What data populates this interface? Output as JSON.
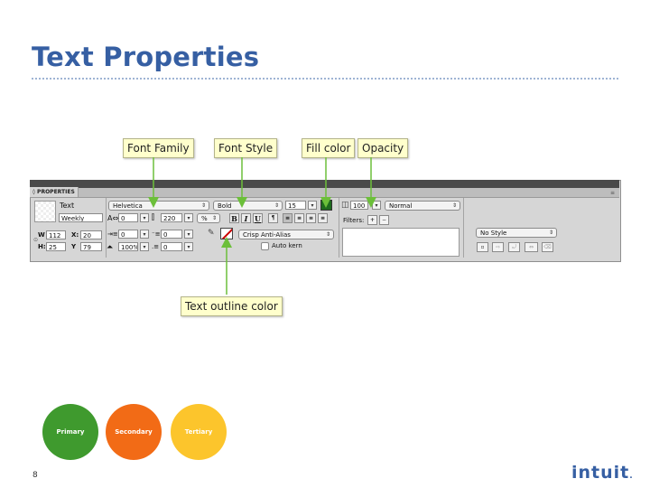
{
  "slide": {
    "title": "Text Properties",
    "page_number": "8",
    "logo_text": "intuit",
    "logo_mark": "."
  },
  "callouts": {
    "font_family": "Font Family",
    "font_style": "Font Style",
    "fill_color": "Fill color",
    "opacity": "Opacity",
    "text_outline_color": "Text outline color"
  },
  "panel": {
    "tab_label": "◊ PROPERTIES",
    "object_type": "Text",
    "object_name": "Weekly",
    "w_label": "W",
    "w_value": "112",
    "h_label": "H:",
    "h_value": "25",
    "x_label": "X:",
    "x_value": "20",
    "y_label": "Y",
    "y_value": "79",
    "font_family": "Helvetica",
    "font_style": "Bold",
    "font_size": "15",
    "kerning": "0",
    "leading": "220",
    "leading_unit": "%",
    "indent": "0",
    "space_before": "0",
    "space_after": "0",
    "horizontal_scale": "100%",
    "baseline_shift": "0",
    "bold_label": "B",
    "italic_label": "I",
    "underline_label": "U",
    "anti_alias": "Crisp Anti-Alias",
    "auto_kern": "Auto kern",
    "opacity_value": "100",
    "blend_mode": "Normal",
    "filters_label": "Filters:",
    "add_filter": "+",
    "remove_filter": "−",
    "style": "No Style",
    "fill_color": "#1e6b1e",
    "stroke_color": "#cc0000"
  },
  "legend": {
    "primary": "Primary",
    "secondary": "Secondary",
    "tertiary": "Tertiary"
  },
  "colors": {
    "title": "#365fa3",
    "primary": "#3f9a2e",
    "secondary": "#f26b16",
    "tertiary": "#fcc52c",
    "callout_bg": "#ffffcc",
    "arrow": "#6cbf3a"
  }
}
